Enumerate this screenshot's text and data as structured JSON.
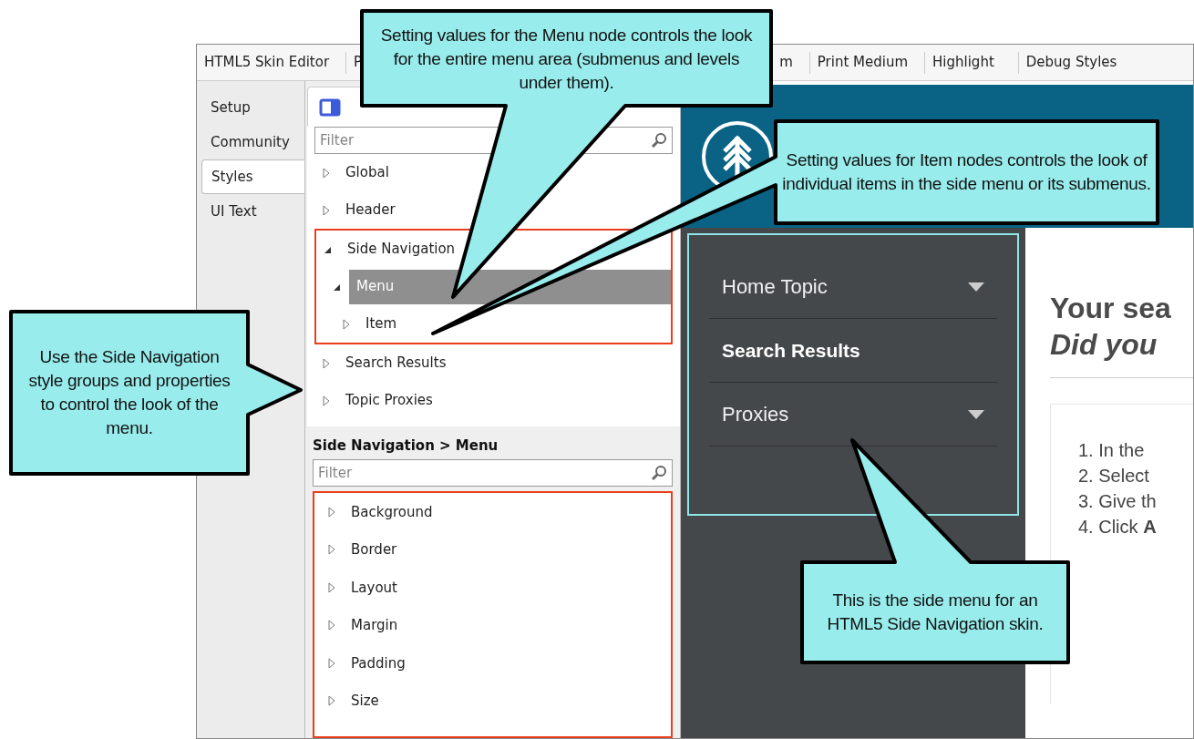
{
  "editor": {
    "toolbar_tabs": [
      "HTML5 Skin Editor",
      "P",
      "m",
      "Print Medium",
      "Highlight",
      "Debug Styles"
    ]
  },
  "side_tabs": [
    {
      "label": "Setup",
      "selected": false
    },
    {
      "label": "Community",
      "selected": false
    },
    {
      "label": "Styles",
      "selected": true
    },
    {
      "label": "UI Text",
      "selected": false
    }
  ],
  "style_tree": {
    "filter_placeholder": "Filter",
    "items": [
      {
        "label": "Global",
        "expanded": false,
        "selected": false,
        "highlighted": false
      },
      {
        "label": "Header",
        "expanded": false,
        "selected": false,
        "highlighted": false
      },
      {
        "label": "Side Navigation",
        "expanded": true,
        "selected": false,
        "highlighted": true,
        "children": [
          {
            "label": "Menu",
            "expanded": true,
            "selected": true,
            "highlighted": false,
            "children": [
              {
                "label": "Item",
                "expanded": false,
                "selected": false,
                "highlighted": false
              }
            ]
          }
        ]
      },
      {
        "label": "Search Results",
        "expanded": false,
        "selected": false,
        "highlighted": false
      },
      {
        "label": "Topic Proxies",
        "expanded": false,
        "selected": false,
        "highlighted": false
      }
    ]
  },
  "properties": {
    "title": "Side Navigation > Menu",
    "filter_placeholder": "Filter",
    "highlighted": true,
    "groups": [
      {
        "label": "Background",
        "expanded": false
      },
      {
        "label": "Border",
        "expanded": false
      },
      {
        "label": "Layout",
        "expanded": false
      },
      {
        "label": "Margin",
        "expanded": false
      },
      {
        "label": "Padding",
        "expanded": false
      },
      {
        "label": "Size",
        "expanded": false
      }
    ]
  },
  "preview": {
    "highlighted": true,
    "menu": [
      {
        "label": "Home Topic",
        "has_submenu": true,
        "current": false
      },
      {
        "label": "Search Results",
        "has_submenu": false,
        "current": true
      },
      {
        "label": "Proxies",
        "has_submenu": true,
        "current": false
      }
    ],
    "heading": "Your sea",
    "subheading": "Did you",
    "steps": [
      "1. In the",
      "2. Select",
      "3. Give th",
      "4. Click **A**"
    ]
  },
  "callouts": [
    {
      "text": "Setting values for the Menu node controls the look for the entire menu area (submenus and levels under them)."
    },
    {
      "text": "Setting values for Item nodes controls the look of individual items in the side menu or its submenus."
    },
    {
      "text": "Use the Side Navigation style groups and properties to control the look of the menu."
    },
    {
      "text": "This is the side menu for an HTML5 Side Navigation skin."
    }
  ]
}
